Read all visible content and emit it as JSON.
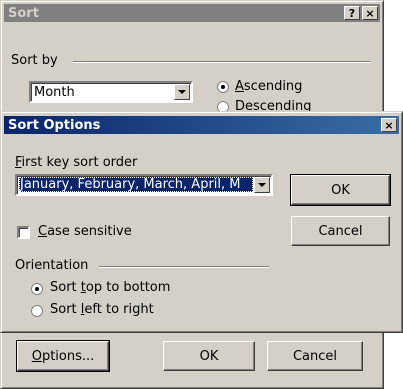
{
  "sort_dialog": {
    "title": "Sort",
    "help_btn": "?",
    "close_btn": "×",
    "sort_by_label": "Sort by",
    "sort_by_value": "Month",
    "ascending_label": [
      "",
      "A",
      "scending"
    ],
    "descending_label": [
      "",
      "D",
      "escending"
    ],
    "options_button": [
      "",
      "O",
      "ptions..."
    ],
    "ok_button": "OK",
    "cancel_button": "Cancel"
  },
  "sort_options": {
    "title": "Sort Options",
    "close_btn": "×",
    "first_key_label": [
      "",
      "F",
      "irst key sort order"
    ],
    "first_key_value": "January, February, March, April, M",
    "ok_button": "OK",
    "cancel_button": "Cancel",
    "case_sensitive_label": [
      "",
      "C",
      "ase sensitive"
    ],
    "orientation_label": "Orientation",
    "top_to_bottom_label": [
      "Sort ",
      "t",
      "op to bottom"
    ],
    "left_to_right_label": [
      "Sort ",
      "l",
      "eft to right"
    ]
  },
  "colors": {
    "active_title": "#0a246a",
    "inactive_title": "#808080",
    "face": "#d4d0c8",
    "selection": "#0a246a"
  }
}
